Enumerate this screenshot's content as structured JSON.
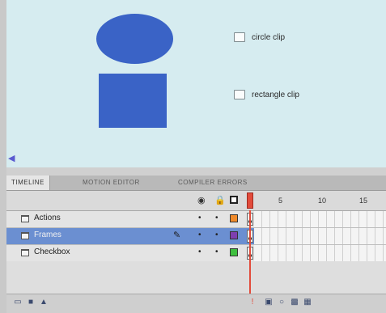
{
  "stage": {
    "shape_color": "#3a63c6",
    "checkboxes": [
      {
        "label": "circle clip",
        "checked": false
      },
      {
        "label": "rectangle clip",
        "checked": false
      }
    ],
    "scroll_left_icon": "arrow-left-icon"
  },
  "panel": {
    "tabs": [
      {
        "label": "TIMELINE",
        "active": true
      },
      {
        "label": "MOTION EDITOR",
        "active": false
      },
      {
        "label": "COMPILER ERRORS",
        "active": false
      }
    ],
    "header": {
      "eye_icon": "eye-icon",
      "lock_icon": "lock-icon",
      "outline_icon": "outline-icon",
      "frame_numbers": [
        "5",
        "10",
        "15"
      ]
    },
    "layers": [
      {
        "name": "Actions",
        "color": "#f08a2a",
        "selected": false,
        "editing": false
      },
      {
        "name": "Frames",
        "color": "#7e3fb0",
        "selected": true,
        "editing": true
      },
      {
        "name": "Checkbox",
        "color": "#3fbf3f",
        "selected": false,
        "editing": false
      }
    ],
    "footer_icons": [
      "new-layer-icon",
      "new-folder-icon",
      "delete-layer-icon",
      "center-frame-icon",
      "onion-skin-icon",
      "onion-outline-icon",
      "edit-multiple-frames-icon",
      "modify-markers-icon"
    ]
  }
}
